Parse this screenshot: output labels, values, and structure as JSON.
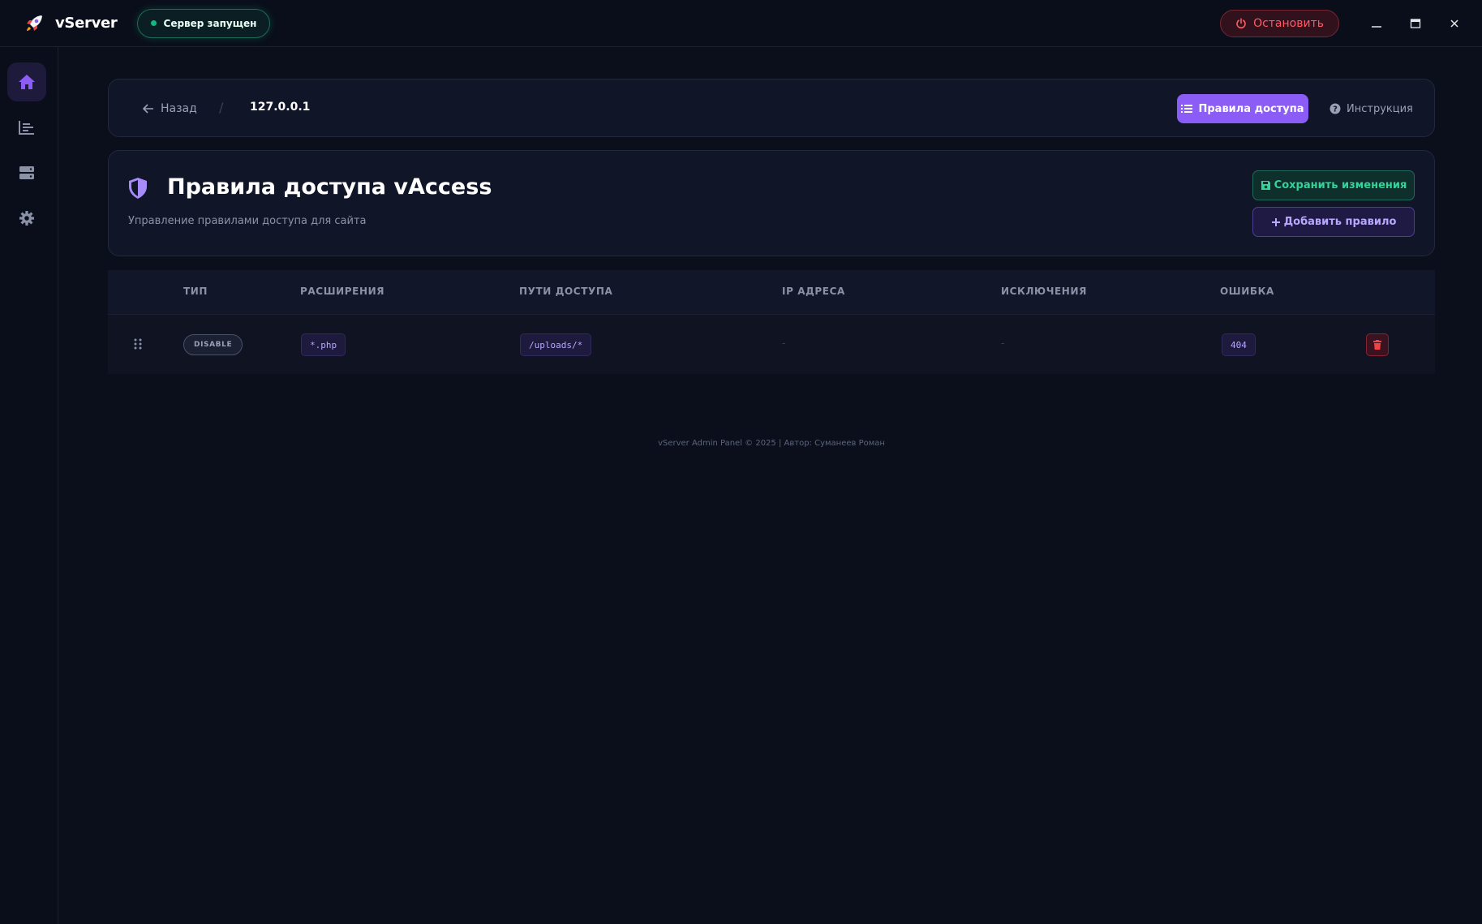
{
  "app": {
    "name": "vServer",
    "server_status": "Сервер запущен",
    "stop_label": "Остановить"
  },
  "sidebar": {
    "items": [
      {
        "icon": "home-icon",
        "active": true
      },
      {
        "icon": "chart-icon",
        "active": false
      },
      {
        "icon": "server-icon",
        "active": false
      },
      {
        "icon": "gear-icon",
        "active": false
      }
    ]
  },
  "breadcrumbs": {
    "back_label": "Назад",
    "separator": "/",
    "current": "127.0.0.1",
    "rules_label": "Правила доступа",
    "help_label": "Инструкция"
  },
  "header": {
    "title": "Правила доступа vAccess",
    "subtitle": "Управление правилами доступа для сайта",
    "save_label": "Сохранить изменения",
    "add_label": "Добавить правило"
  },
  "table": {
    "columns": [
      "ТИП",
      "РАСШИРЕНИЯ",
      "ПУТИ ДОСТУПА",
      "IP АДРЕСА",
      "ИСКЛЮЧЕНИЯ",
      "ОШИБКА"
    ],
    "rows": [
      {
        "type": "DISABLE",
        "extensions": "*.php",
        "paths": "/uploads/*",
        "ips": "-",
        "exceptions": "-",
        "error": "404"
      }
    ]
  },
  "footer": "vServer Admin Panel © 2025 | Автор: Суманеев Роман",
  "colors": {
    "accent": "#8b5cf6",
    "success": "#10b981",
    "danger": "#ef4444",
    "background": "#0b0f1c"
  }
}
